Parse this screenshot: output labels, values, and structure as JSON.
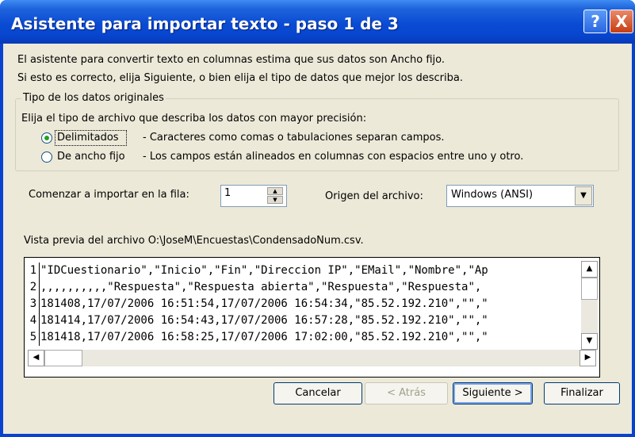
{
  "window": {
    "title": "Asistente para importar texto - paso 1 de 3",
    "help_label": "?",
    "close_label": "X"
  },
  "intro": {
    "line1": "El asistente para convertir texto en columnas estima que sus datos son Ancho fijo.",
    "line2": "Si esto es correcto, elija Siguiente, o bien elija el tipo de datos que mejor los describa."
  },
  "data_type": {
    "group_title": "Tipo de los datos originales",
    "prompt": "Elija el tipo de archivo que describa los datos con mayor precisión:",
    "options": [
      {
        "label": "Delimitados",
        "description": "- Caracteres como comas o tabulaciones separan campos.",
        "selected": true
      },
      {
        "label": "De ancho fijo",
        "description": "- Los campos están alineados en columnas con espacios entre uno y otro.",
        "selected": false
      }
    ]
  },
  "start_row": {
    "label": "Comenzar a importar en la fila:",
    "value": "1"
  },
  "file_origin": {
    "label": "Origen del archivo:",
    "value": "Windows (ANSI)"
  },
  "preview": {
    "label": "Vista previa del archivo O:\\JoseM\\Encuestas\\CondensadoNum.csv.",
    "rows": [
      {
        "num": "1",
        "text": "\"IDCuestionario\",\"Inicio\",\"Fin\",\"Direccion IP\",\"EMail\",\"Nombre\",\"Ap"
      },
      {
        "num": "2",
        "text": ",,,,,,,,,,\"Respuesta\",\"Respuesta abierta\",\"Respuesta\",\"Respuesta\","
      },
      {
        "num": "3",
        "text": "181408,17/07/2006 16:51:54,17/07/2006 16:54:34,\"85.52.192.210\",\"\",\""
      },
      {
        "num": "4",
        "text": "181414,17/07/2006 16:54:43,17/07/2006 16:57:28,\"85.52.192.210\",\"\",\""
      },
      {
        "num": "5",
        "text": "181418,17/07/2006 16:58:25,17/07/2006 17:02:00,\"85.52.192.210\",\"\",\""
      }
    ]
  },
  "buttons": {
    "cancel": "Cancelar",
    "back": "< Atrás",
    "next": "Siguiente >",
    "finish": "Finalizar"
  },
  "icons": {
    "up": "▲",
    "down": "▼",
    "left": "◀",
    "right": "▶"
  }
}
